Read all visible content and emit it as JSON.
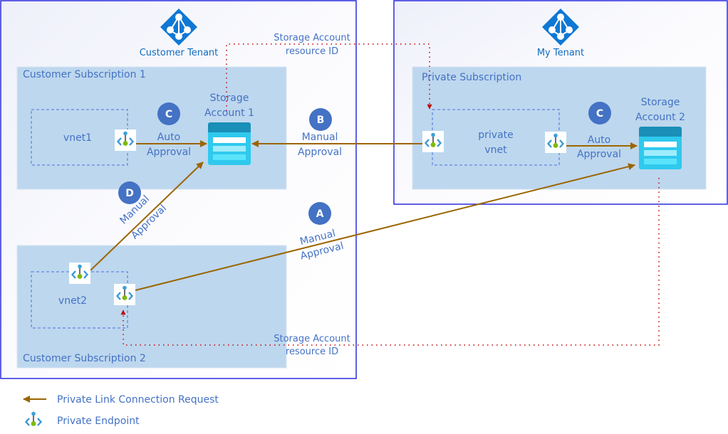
{
  "colors": {
    "tenant_border": "#2b2bdf",
    "subscription_fill": "#bdd7ee",
    "vnet_border": "#4a6fe3",
    "arrow": "#9c6500",
    "resource_id_line": "#c00000",
    "badge": "#4472c4",
    "label_text": "#4472c4",
    "tenant_icon": "#0f78d4",
    "storage_header": "#1a8fb8",
    "storage_body": "#31d0f0"
  },
  "tenants": [
    {
      "name": "Customer Tenant",
      "icon": "azure-ad-icon"
    },
    {
      "name": "My Tenant",
      "icon": "azure-ad-icon"
    }
  ],
  "subscriptions": [
    {
      "name": "Customer Subscription 1"
    },
    {
      "name": "Customer Subscription 2"
    },
    {
      "name": "Private Subscription"
    }
  ],
  "vnets": [
    {
      "name": "vnet1"
    },
    {
      "name": "vnet2"
    },
    {
      "name_line1": "private",
      "name_line2": "vnet"
    }
  ],
  "storage_accounts": [
    {
      "line1": "Storage",
      "line2": "Account 1",
      "icon": "storage-account-icon"
    },
    {
      "line1": "Storage",
      "line2": "Account 2",
      "icon": "storage-account-icon"
    }
  ],
  "badges": {
    "a": "A",
    "b": "B",
    "c1": "C",
    "c2": "C",
    "d": "D"
  },
  "connections": {
    "auto_line1": "Auto",
    "auto_line2": "Approval",
    "manual_line1": "Manual",
    "manual_line2": "Approval"
  },
  "resource_id_labels": {
    "line1": "Storage Account",
    "line2": "resource ID"
  },
  "legend": {
    "connection_request": "Private Link Connection Request",
    "private_endpoint": "Private Endpoint"
  }
}
